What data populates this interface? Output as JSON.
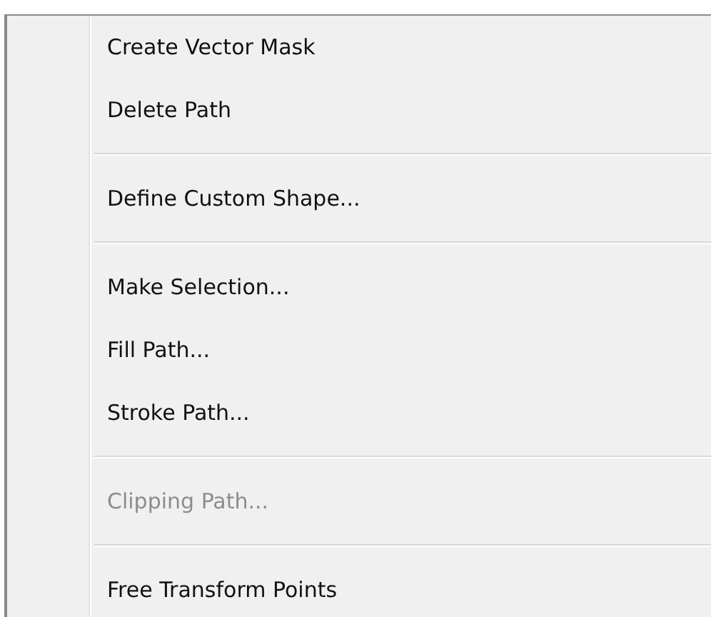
{
  "menu": {
    "items": [
      {
        "kind": "item",
        "label": "Create Vector Mask",
        "disabled": false
      },
      {
        "kind": "item",
        "label": "Delete Path",
        "disabled": false
      },
      {
        "kind": "separator"
      },
      {
        "kind": "item",
        "label": "Define Custom Shape...",
        "disabled": false
      },
      {
        "kind": "separator"
      },
      {
        "kind": "item",
        "label": "Make Selection...",
        "disabled": false
      },
      {
        "kind": "item",
        "label": "Fill Path...",
        "disabled": false
      },
      {
        "kind": "item",
        "label": "Stroke Path...",
        "disabled": false
      },
      {
        "kind": "separator"
      },
      {
        "kind": "item",
        "label": "Clipping Path...",
        "disabled": true
      },
      {
        "kind": "separator"
      },
      {
        "kind": "item",
        "label": "Free Transform Points",
        "disabled": false
      }
    ]
  }
}
